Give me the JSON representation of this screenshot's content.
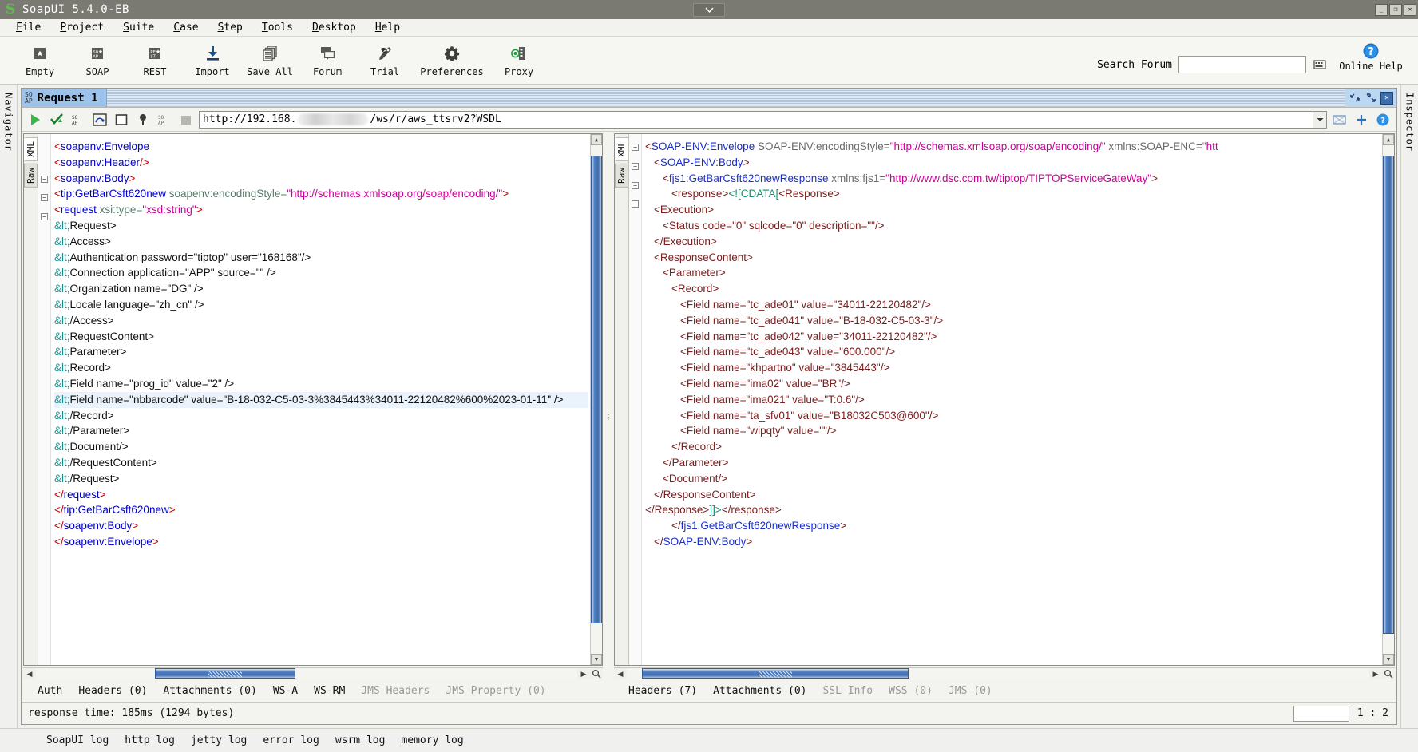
{
  "window": {
    "title": "SoapUI 5.4.0-EB",
    "logo_icon": "soapui-s-logo-icon",
    "center_btn_icon": "chevron-down-icon",
    "minimize_label": "_",
    "maximize_label": "❐",
    "close_label": "✕"
  },
  "menubar": {
    "items": [
      {
        "pre": "F",
        "post": "ile",
        "name": "file"
      },
      {
        "pre": "P",
        "post": "roject",
        "name": "project"
      },
      {
        "pre": "S",
        "post": "uite",
        "name": "suite"
      },
      {
        "pre": "C",
        "post": "ase",
        "name": "case"
      },
      {
        "pre": "S",
        "post": "tep",
        "name": "step"
      },
      {
        "pre": "T",
        "post": "ools",
        "name": "tools"
      },
      {
        "pre": "D",
        "post": "esktop",
        "name": "desktop"
      },
      {
        "pre": "H",
        "post": "elp",
        "name": "help"
      }
    ]
  },
  "toolbar": {
    "buttons": [
      {
        "label": "Empty",
        "icon": "empty-project-icon"
      },
      {
        "label": "SOAP",
        "icon": "soap-project-icon"
      },
      {
        "label": "REST",
        "icon": "rest-project-icon"
      },
      {
        "label": "Import",
        "icon": "import-icon"
      },
      {
        "label": "Save All",
        "icon": "save-all-icon"
      },
      {
        "label": "Forum",
        "icon": "forum-icon"
      },
      {
        "label": "Trial",
        "icon": "trial-icon"
      },
      {
        "label": "Preferences",
        "icon": "gear-icon"
      },
      {
        "label": "Proxy",
        "icon": "proxy-icon"
      }
    ],
    "search_label": "Search Forum",
    "search_value": "",
    "search_placeholder": "",
    "search_go_icon": "search-submit-icon",
    "online_help_label": "Online Help",
    "online_help_icon": "question-circle-icon"
  },
  "rails": {
    "left_label": "Navigator",
    "right_label": "Inspector"
  },
  "request_window": {
    "tab_badge_top": "SO",
    "tab_badge_bottom": "AP",
    "tab_label": "Request 1",
    "ctrl_restore_icon": "restore-window-icon",
    "ctrl_maximize_icon": "maximize-window-icon",
    "ctrl_close_icon": "close-window-icon"
  },
  "request_toolbar": {
    "buttons": [
      {
        "name": "submit-request-button",
        "icon": "play-green-icon"
      },
      {
        "name": "validate-button",
        "icon": "check-green-icon"
      },
      {
        "name": "create-soap-request-button",
        "icon": "soap-small-icon"
      },
      {
        "name": "add-assertion-button",
        "icon": "assertion-icon"
      },
      {
        "name": "add-to-testcase-button",
        "icon": "square-outline-icon"
      },
      {
        "name": "add-attachment-button",
        "icon": "pin-icon"
      },
      {
        "name": "raw-view-button",
        "icon": "soap-small-alt-icon"
      },
      {
        "name": "stop-button",
        "icon": "stop-grey-icon"
      }
    ],
    "url_prefix": "http://192.168.",
    "url_redacted": true,
    "url_suffix": "/ws/r/aws_ttsrv2?WSDL",
    "dropdown_icon": "chevron-down-icon",
    "right_buttons": [
      {
        "name": "endpoint-config-button",
        "icon": "endpoint-icon"
      },
      {
        "name": "add-endpoint-button",
        "icon": "plus-icon"
      },
      {
        "name": "help-button",
        "icon": "question-circle-icon"
      }
    ]
  },
  "request_editor": {
    "side_tabs": [
      {
        "label": "XML",
        "active": true
      },
      {
        "label": "Raw",
        "active": false
      }
    ],
    "lines": [
      {
        "fold": false,
        "indent": 0,
        "clipped_top": true,
        "segs": [
          {
            "c": "t-ang",
            "t": "<"
          },
          {
            "c": "t-tag",
            "t": "soapenv:Envelope"
          }
        ]
      },
      {
        "fold": false,
        "indent": 0,
        "segs": [
          {
            "c": "t-ang",
            "t": "<"
          },
          {
            "c": "t-tag",
            "t": "soapenv:Header"
          },
          {
            "c": "t-ang",
            "t": "/>"
          }
        ]
      },
      {
        "fold": true,
        "indent": 0,
        "segs": [
          {
            "c": "t-ang",
            "t": "<"
          },
          {
            "c": "t-tag",
            "t": "soapenv:Body"
          },
          {
            "c": "t-ang",
            "t": ">"
          }
        ]
      },
      {
        "fold": true,
        "indent": 0,
        "segs": [
          {
            "c": "t-ang",
            "t": "<"
          },
          {
            "c": "t-tag",
            "t": "tip:GetBarCsft620new"
          },
          {
            "c": "t-attr",
            "t": " soapenv:encodingStyle="
          },
          {
            "c": "t-val",
            "t": "\"http://schemas.xmlsoap.org/soap/encoding/\""
          },
          {
            "c": "t-ang",
            "t": ">"
          }
        ]
      },
      {
        "fold": true,
        "indent": 0,
        "segs": [
          {
            "c": "t-ang",
            "t": "<"
          },
          {
            "c": "t-tag",
            "t": "request"
          },
          {
            "c": "t-attr",
            "t": " xsi:type="
          },
          {
            "c": "t-val",
            "t": "\"xsd:string\""
          },
          {
            "c": "t-ang",
            "t": ">"
          }
        ]
      },
      {
        "fold": false,
        "indent": 0,
        "segs": [
          {
            "c": "t-ent",
            "t": "&lt;"
          },
          {
            "c": "t-txt",
            "t": "Request>"
          }
        ]
      },
      {
        "fold": false,
        "indent": 0,
        "segs": [
          {
            "c": "t-ent",
            "t": "&lt;"
          },
          {
            "c": "t-txt",
            "t": "Access>"
          }
        ]
      },
      {
        "fold": false,
        "indent": 0,
        "segs": [
          {
            "c": "t-ent",
            "t": "&lt;"
          },
          {
            "c": "t-txt",
            "t": "Authentication password=\"tiptop\" user=\"168168\"/>"
          }
        ]
      },
      {
        "fold": false,
        "indent": 0,
        "segs": [
          {
            "c": "t-ent",
            "t": "&lt;"
          },
          {
            "c": "t-txt",
            "t": "Connection application=\"APP\" source=\"\" />"
          }
        ]
      },
      {
        "fold": false,
        "indent": 0,
        "segs": [
          {
            "c": "t-ent",
            "t": "&lt;"
          },
          {
            "c": "t-txt",
            "t": "Organization name=\"DG\" />"
          }
        ]
      },
      {
        "fold": false,
        "indent": 0,
        "segs": [
          {
            "c": "t-ent",
            "t": "&lt;"
          },
          {
            "c": "t-txt",
            "t": "Locale language=\"zh_cn\" />"
          }
        ]
      },
      {
        "fold": false,
        "indent": 0,
        "segs": [
          {
            "c": "t-ent",
            "t": "&lt;"
          },
          {
            "c": "t-txt",
            "t": "/Access>"
          }
        ]
      },
      {
        "fold": false,
        "indent": 0,
        "segs": [
          {
            "c": "t-ent",
            "t": "&lt;"
          },
          {
            "c": "t-txt",
            "t": "RequestContent>"
          }
        ]
      },
      {
        "fold": false,
        "indent": 0,
        "segs": [
          {
            "c": "t-ent",
            "t": "&lt;"
          },
          {
            "c": "t-txt",
            "t": "Parameter>"
          }
        ]
      },
      {
        "fold": false,
        "indent": 0,
        "segs": [
          {
            "c": "t-ent",
            "t": "&lt;"
          },
          {
            "c": "t-txt",
            "t": "Record>"
          }
        ]
      },
      {
        "fold": false,
        "indent": 0,
        "segs": [
          {
            "c": "t-ent",
            "t": "&lt;"
          },
          {
            "c": "t-txt",
            "t": "Field name=\"prog_id\" value=\"2\" />"
          }
        ]
      },
      {
        "fold": false,
        "indent": 0,
        "hl": true,
        "segs": [
          {
            "c": "t-ent",
            "t": "&lt;"
          },
          {
            "c": "t-txt",
            "t": "Field name=\"nbbarcode\" value=\"B-18-032-C5-03-3%3845443%34011-22120482%600%2023-01-11\" />"
          }
        ]
      },
      {
        "fold": false,
        "indent": 0,
        "segs": [
          {
            "c": "t-ent",
            "t": "&lt;"
          },
          {
            "c": "t-txt",
            "t": "/Record>"
          }
        ]
      },
      {
        "fold": false,
        "indent": 0,
        "segs": [
          {
            "c": "t-ent",
            "t": "&lt;"
          },
          {
            "c": "t-txt",
            "t": "/Parameter>"
          }
        ]
      },
      {
        "fold": false,
        "indent": 0,
        "segs": [
          {
            "c": "t-ent",
            "t": "&lt;"
          },
          {
            "c": "t-txt",
            "t": "Document/>"
          }
        ]
      },
      {
        "fold": false,
        "indent": 0,
        "segs": [
          {
            "c": "t-ent",
            "t": "&lt;"
          },
          {
            "c": "t-txt",
            "t": "/RequestContent>"
          }
        ]
      },
      {
        "fold": false,
        "indent": 0,
        "segs": [
          {
            "c": "t-ent",
            "t": "&lt;"
          },
          {
            "c": "t-txt",
            "t": "/Request>"
          }
        ]
      },
      {
        "fold": false,
        "indent": 0,
        "segs": [
          {
            "c": "t-ang",
            "t": "</"
          },
          {
            "c": "t-tag",
            "t": "request"
          },
          {
            "c": "t-ang",
            "t": ">"
          }
        ]
      },
      {
        "fold": false,
        "indent": 0,
        "segs": [
          {
            "c": "t-ang",
            "t": "</"
          },
          {
            "c": "t-tag",
            "t": "tip:GetBarCsft620new"
          },
          {
            "c": "t-ang",
            "t": ">"
          }
        ]
      },
      {
        "fold": false,
        "indent": 0,
        "segs": [
          {
            "c": "t-ang",
            "t": "</"
          },
          {
            "c": "t-tag",
            "t": "soapenv:Body"
          },
          {
            "c": "t-ang",
            "t": ">"
          }
        ]
      },
      {
        "fold": false,
        "indent": 0,
        "segs": [
          {
            "c": "t-ang",
            "t": "</"
          },
          {
            "c": "t-tag",
            "t": "soapenv:Envelope"
          },
          {
            "c": "t-ang",
            "t": ">"
          }
        ]
      }
    ],
    "tabs": [
      {
        "label": "Auth",
        "count": null,
        "dim": false
      },
      {
        "label": "Headers",
        "count": "(0)",
        "dim": false
      },
      {
        "label": "Attachments",
        "count": "(0)",
        "dim": false
      },
      {
        "label": "WS-A",
        "count": null,
        "dim": false
      },
      {
        "label": "WS-RM",
        "count": null,
        "dim": false
      },
      {
        "label": "JMS Headers",
        "count": null,
        "dim": true
      },
      {
        "label": "JMS Property",
        "count": "(0)",
        "dim": true
      }
    ]
  },
  "response_editor": {
    "side_tabs": [
      {
        "label": "XML",
        "active": true
      },
      {
        "label": "Raw",
        "active": false
      }
    ],
    "lines": [
      {
        "fold": true,
        "indent": 0,
        "segs": [
          {
            "c": "t-rang",
            "t": "<"
          },
          {
            "c": "t-blue",
            "t": "SOAP-ENV:Envelope"
          },
          {
            "c": "t-rattr",
            "t": " SOAP-ENV:encodingStyle="
          },
          {
            "c": "t-rval",
            "t": "\"http://schemas.xmlsoap.org/soap/encoding/\""
          },
          {
            "c": "t-rattr",
            "t": " xmlns:SOAP-ENC=\""
          },
          {
            "c": "t-rval",
            "t": "htt"
          }
        ]
      },
      {
        "fold": true,
        "indent": 1,
        "segs": [
          {
            "c": "t-rang",
            "t": "<"
          },
          {
            "c": "t-blue",
            "t": "SOAP-ENV:Body"
          },
          {
            "c": "t-rang",
            "t": ">"
          }
        ]
      },
      {
        "fold": true,
        "indent": 2,
        "segs": [
          {
            "c": "t-rang",
            "t": "<"
          },
          {
            "c": "t-blue",
            "t": "fjs1:GetBarCsft620newResponse"
          },
          {
            "c": "t-rattr",
            "t": " xmlns:fjs1="
          },
          {
            "c": "t-rval",
            "t": "\"http://www.dsc.com.tw/tiptop/TIPTOPServiceGateWay\""
          },
          {
            "c": "t-rang",
            "t": ">"
          }
        ]
      },
      {
        "fold": true,
        "indent": 3,
        "segs": [
          {
            "c": "t-rang",
            "t": "<"
          },
          {
            "c": "t-rtag",
            "t": "response"
          },
          {
            "c": "t-rang",
            "t": ">"
          },
          {
            "c": "t-cdata",
            "t": "<![CDATA["
          },
          {
            "c": "t-rtag",
            "t": "<Response>"
          }
        ]
      },
      {
        "fold": false,
        "indent": 1,
        "segs": [
          {
            "c": "t-rtag",
            "t": "<Execution>"
          }
        ]
      },
      {
        "fold": false,
        "indent": 2,
        "segs": [
          {
            "c": "t-rtag",
            "t": "<Status code=\"0\" sqlcode=\"0\" description=\"\"/>"
          }
        ]
      },
      {
        "fold": false,
        "indent": 1,
        "segs": [
          {
            "c": "t-rtag",
            "t": "</Execution>"
          }
        ]
      },
      {
        "fold": false,
        "indent": 1,
        "segs": [
          {
            "c": "t-rtag",
            "t": "<ResponseContent>"
          }
        ]
      },
      {
        "fold": false,
        "indent": 2,
        "segs": [
          {
            "c": "t-rtag",
            "t": "<Parameter>"
          }
        ]
      },
      {
        "fold": false,
        "indent": 3,
        "segs": [
          {
            "c": "t-rtag",
            "t": "<Record>"
          }
        ]
      },
      {
        "fold": false,
        "indent": 4,
        "segs": [
          {
            "c": "t-rtag",
            "t": "<Field name=\"tc_ade01\" value=\"34011-22120482\"/>"
          }
        ]
      },
      {
        "fold": false,
        "indent": 4,
        "segs": [
          {
            "c": "t-rtag",
            "t": "<Field name=\"tc_ade041\" value=\"B-18-032-C5-03-3\"/>"
          }
        ]
      },
      {
        "fold": false,
        "indent": 4,
        "segs": [
          {
            "c": "t-rtag",
            "t": "<Field name=\"tc_ade042\" value=\"34011-22120482\"/>"
          }
        ]
      },
      {
        "fold": false,
        "indent": 4,
        "segs": [
          {
            "c": "t-rtag",
            "t": "<Field name=\"tc_ade043\" value=\"600.000\"/>"
          }
        ]
      },
      {
        "fold": false,
        "indent": 4,
        "segs": [
          {
            "c": "t-rtag",
            "t": "<Field name=\"khpartno\" value=\"3845443\"/>"
          }
        ]
      },
      {
        "fold": false,
        "indent": 4,
        "segs": [
          {
            "c": "t-rtag",
            "t": "<Field name=\"ima02\" value=\"BR\"/>"
          }
        ]
      },
      {
        "fold": false,
        "indent": 4,
        "segs": [
          {
            "c": "t-rtag",
            "t": "<Field name=\"ima021\" value=\"T:0.6\"/>"
          }
        ]
      },
      {
        "fold": false,
        "indent": 4,
        "segs": [
          {
            "c": "t-rtag",
            "t": "<Field name=\"ta_sfv01\" value=\"B18032C503@600\"/>"
          }
        ]
      },
      {
        "fold": false,
        "indent": 4,
        "segs": [
          {
            "c": "t-rtag",
            "t": "<Field name=\"wipqty\" value=\"\"/>"
          }
        ]
      },
      {
        "fold": false,
        "indent": 3,
        "segs": [
          {
            "c": "t-rtag",
            "t": "</Record>"
          }
        ]
      },
      {
        "fold": false,
        "indent": 2,
        "segs": [
          {
            "c": "t-rtag",
            "t": "</Parameter>"
          }
        ]
      },
      {
        "fold": false,
        "indent": 2,
        "segs": [
          {
            "c": "t-rtag",
            "t": "<Document/>"
          }
        ]
      },
      {
        "fold": false,
        "indent": 1,
        "segs": [
          {
            "c": "t-rtag",
            "t": "</ResponseContent>"
          }
        ]
      },
      {
        "fold": false,
        "indent": 0,
        "segs": [
          {
            "c": "t-rtag",
            "t": "</Response>"
          },
          {
            "c": "t-cdata",
            "t": "]]>"
          },
          {
            "c": "t-rang",
            "t": "</"
          },
          {
            "c": "t-rtag",
            "t": "response"
          },
          {
            "c": "t-rang",
            "t": ">"
          }
        ]
      },
      {
        "fold": false,
        "indent": 3,
        "segs": [
          {
            "c": "t-rang",
            "t": "</"
          },
          {
            "c": "t-blue",
            "t": "fjs1:GetBarCsft620newResponse"
          },
          {
            "c": "t-rang",
            "t": ">"
          }
        ]
      },
      {
        "fold": false,
        "indent": 1,
        "segs": [
          {
            "c": "t-rang",
            "t": "</"
          },
          {
            "c": "t-blue",
            "t": "SOAP-ENV:Body"
          },
          {
            "c": "t-rang",
            "t": ">"
          }
        ]
      }
    ],
    "tabs": [
      {
        "label": "Headers",
        "count": "(7)",
        "dim": false
      },
      {
        "label": "Attachments",
        "count": "(0)",
        "dim": false
      },
      {
        "label": "SSL Info",
        "count": null,
        "dim": true
      },
      {
        "label": "WSS",
        "count": "(0)",
        "dim": true
      },
      {
        "label": "JMS",
        "count": "(0)",
        "dim": true
      }
    ]
  },
  "status": {
    "text": "response time: 185ms (1294 bytes)",
    "pager_value": "",
    "pager_text": "1 : 2"
  },
  "logbar": {
    "tabs": [
      "SoapUI log",
      "http log",
      "jetty log",
      "error log",
      "wsrm log",
      "memory log"
    ]
  },
  "colors": {
    "title_bar": "#7a7a73",
    "tab_active": "#9dc3ea",
    "scroll_thumb": "#3f6cae",
    "accent_green": "#5bbf4a",
    "highlight_row": "#eaf2fb"
  }
}
